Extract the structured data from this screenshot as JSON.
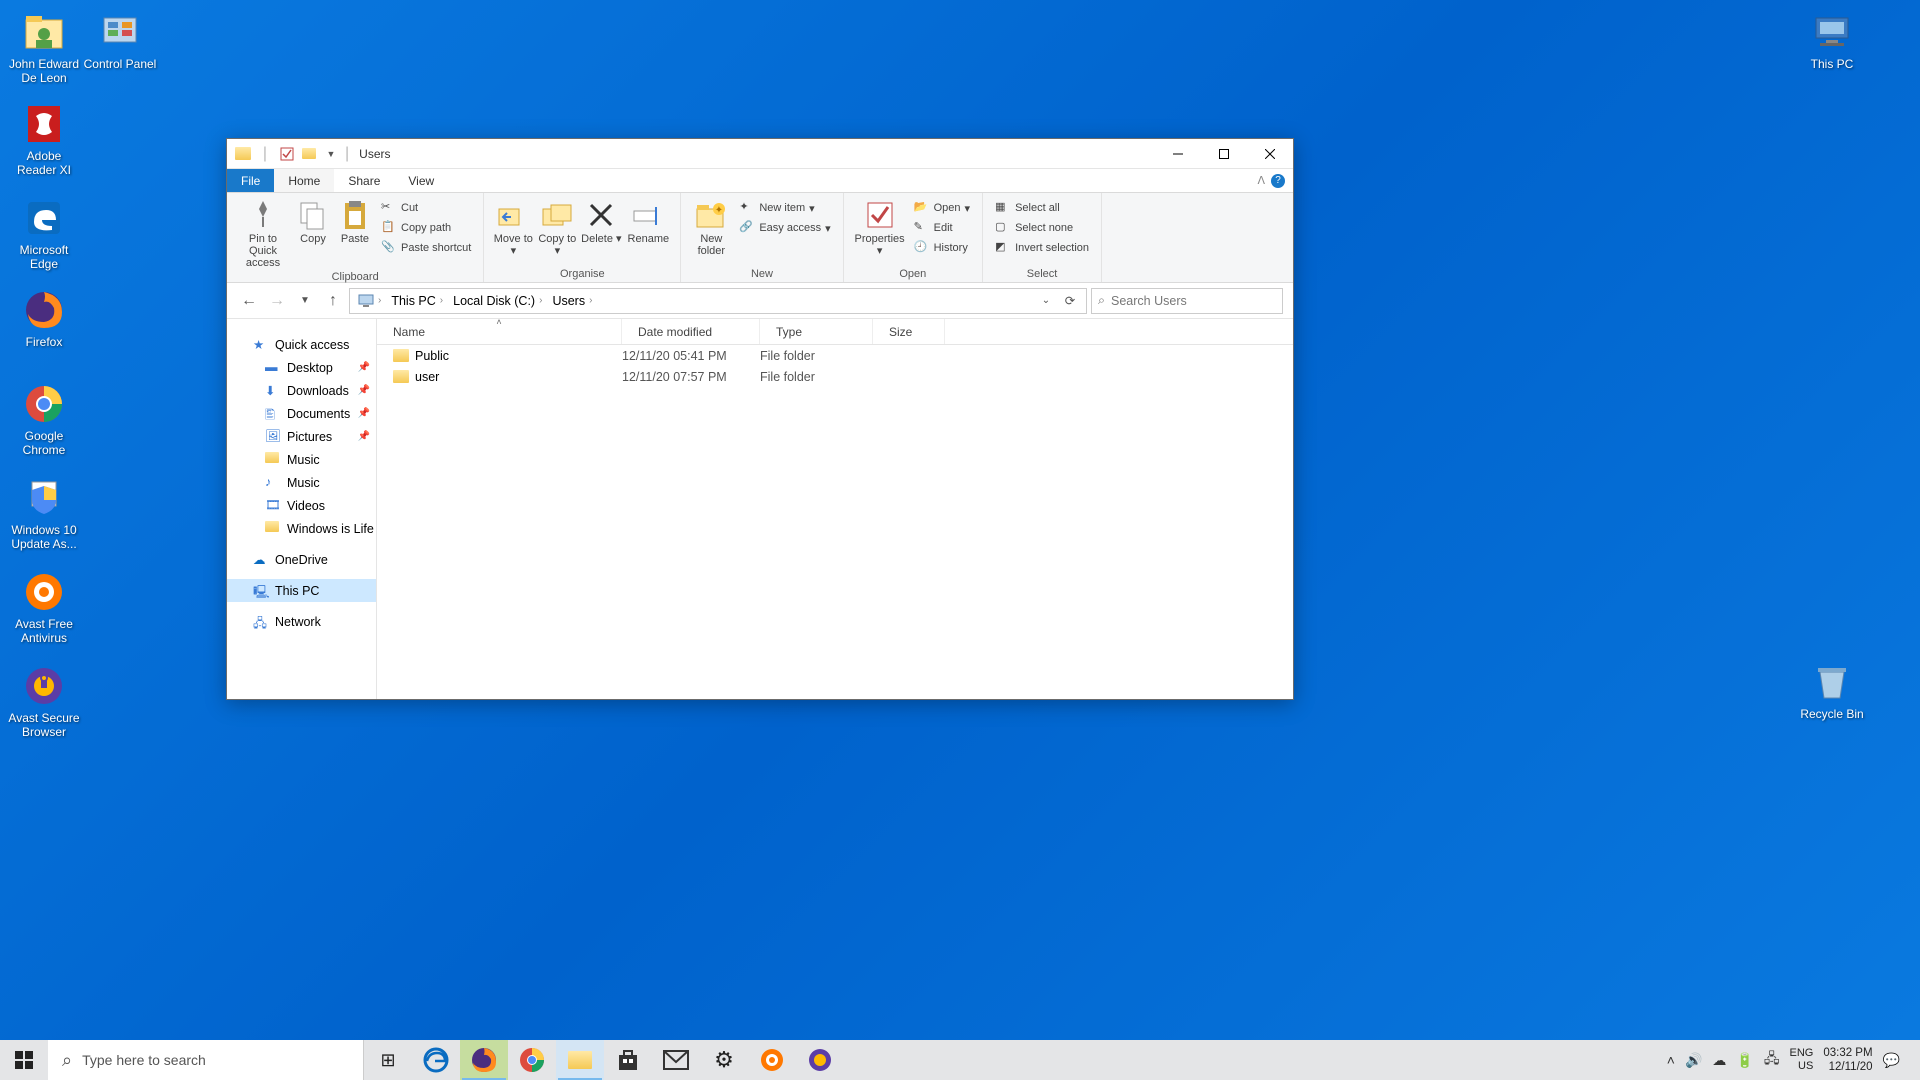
{
  "desktop": {
    "icons_left": [
      {
        "label": "John Edward De Leon"
      },
      {
        "label": "Control Panel"
      },
      {
        "label": "Adobe Reader XI"
      },
      {
        "label": "Microsoft Edge"
      },
      {
        "label": "Firefox"
      },
      {
        "label": "Google Chrome"
      },
      {
        "label": "Windows 10 Update As..."
      },
      {
        "label": "Avast Free Antivirus"
      },
      {
        "label": "Avast Secure Browser"
      }
    ],
    "icons_right": [
      {
        "label": "This PC"
      },
      {
        "label": "Recycle Bin"
      }
    ]
  },
  "explorer": {
    "title": "Users",
    "menu": {
      "file": "File",
      "home": "Home",
      "share": "Share",
      "view": "View"
    },
    "ribbon": {
      "pin": "Pin to Quick access",
      "copy": "Copy",
      "paste": "Paste",
      "cut": "Cut",
      "copypath": "Copy path",
      "pasteshort": "Paste shortcut",
      "moveto": "Move to",
      "copyto": "Copy to",
      "delete": "Delete",
      "rename": "Rename",
      "newfolder": "New folder",
      "newitem": "New item",
      "easyaccess": "Easy access",
      "properties": "Properties",
      "open": "Open",
      "edit": "Edit",
      "history": "History",
      "selectall": "Select all",
      "selectnone": "Select none",
      "invert": "Invert selection",
      "groups": {
        "clipboard": "Clipboard",
        "organise": "Organise",
        "new": "New",
        "open": "Open",
        "select": "Select"
      }
    },
    "breadcrumb": [
      "This PC",
      "Local Disk (C:)",
      "Users"
    ],
    "search_placeholder": "Search Users",
    "nav": {
      "quick": "Quick access",
      "desktop": "Desktop",
      "downloads": "Downloads",
      "documents": "Documents",
      "pictures": "Pictures",
      "music1": "Music",
      "music2": "Music",
      "videos": "Videos",
      "windowsislife": "Windows is Life",
      "onedrive": "OneDrive",
      "thispc": "This PC",
      "network": "Network"
    },
    "columns": {
      "name": "Name",
      "date": "Date modified",
      "type": "Type",
      "size": "Size"
    },
    "rows": [
      {
        "name": "Public",
        "date": "12/11/20 05:41 PM",
        "type": "File folder",
        "size": ""
      },
      {
        "name": "user",
        "date": "12/11/20 07:57 PM",
        "type": "File folder",
        "size": ""
      }
    ]
  },
  "taskbar": {
    "search_placeholder": "Type here to search",
    "lang1": "ENG",
    "lang2": "US",
    "time": "03:32 PM",
    "date": "12/11/20"
  }
}
